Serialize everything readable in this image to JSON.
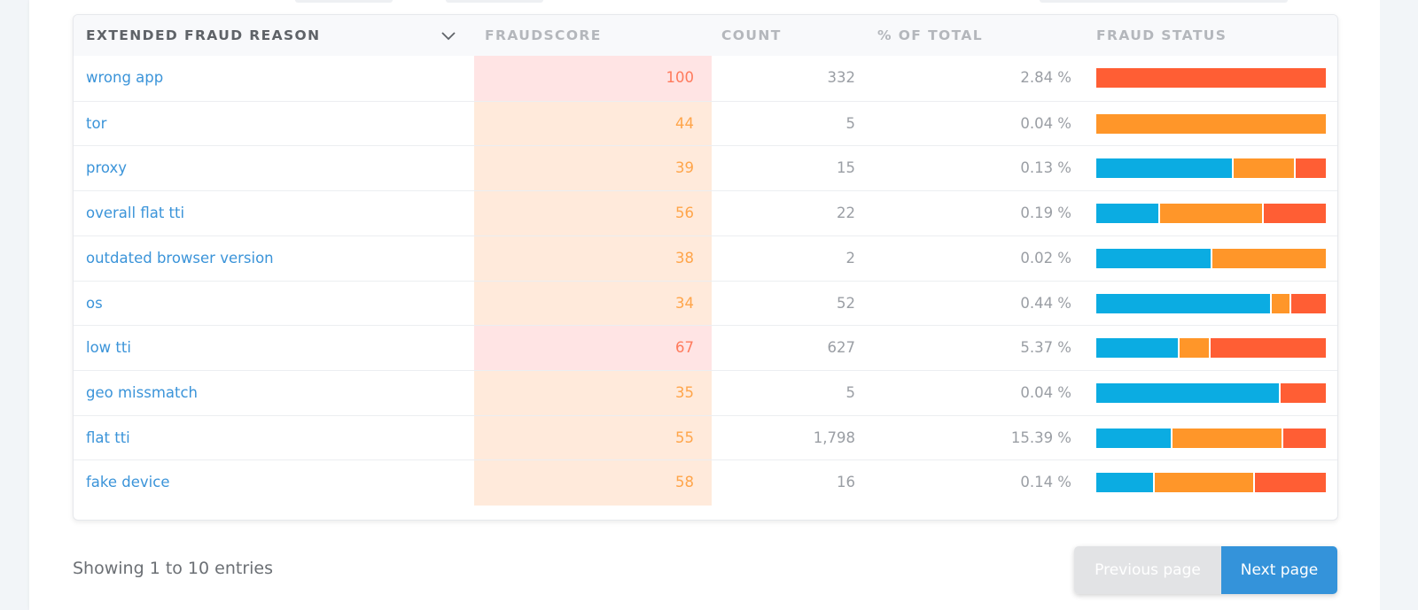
{
  "table": {
    "columns": {
      "reason": "EXTENDED FRAUD REASON",
      "fraudscore": "FRAUDSCORE",
      "count": "COUNT",
      "pct": "% OF TOTAL",
      "status": "FRAUD STATUS"
    },
    "rows": [
      {
        "reason": "wrong app",
        "score": "100",
        "count": "332",
        "pct": "2.84 %",
        "score_level": "high",
        "status_fractions": {
          "clean": 0,
          "suspicious": 0,
          "fraud": 1
        }
      },
      {
        "reason": "tor",
        "score": "44",
        "count": "5",
        "pct": "0.04 %",
        "score_level": "medium",
        "status_fractions": {
          "clean": 0,
          "suspicious": 1,
          "fraud": 0
        }
      },
      {
        "reason": "proxy",
        "score": "39",
        "count": "15",
        "pct": "0.13 %",
        "score_level": "medium",
        "status_fractions": {
          "clean": 0.6,
          "suspicious": 0.267,
          "fraud": 0.133
        }
      },
      {
        "reason": "overall flat tti",
        "score": "56",
        "count": "22",
        "pct": "0.19 %",
        "score_level": "medium",
        "status_fractions": {
          "clean": 0.273,
          "suspicious": 0.455,
          "fraud": 0.273
        }
      },
      {
        "reason": "outdated browser version",
        "score": "38",
        "count": "2",
        "pct": "0.02 %",
        "score_level": "medium",
        "status_fractions": {
          "clean": 0.5,
          "suspicious": 0.5,
          "fraud": 0
        }
      },
      {
        "reason": "os",
        "score": "34",
        "count": "52",
        "pct": "0.44 %",
        "score_level": "medium",
        "status_fractions": {
          "clean": 0.769,
          "suspicious": 0.077,
          "fraud": 0.154
        }
      },
      {
        "reason": "low tti",
        "score": "67",
        "count": "627",
        "pct": "5.37 %",
        "score_level": "high",
        "status_fractions": {
          "clean": 0.36,
          "suspicious": 0.13,
          "fraud": 0.51
        }
      },
      {
        "reason": "geo missmatch",
        "score": "35",
        "count": "5",
        "pct": "0.04 %",
        "score_level": "medium",
        "status_fractions": {
          "clean": 0.8,
          "suspicious": 0,
          "fraud": 0.2
        }
      },
      {
        "reason": "flat tti",
        "score": "55",
        "count": "1,798",
        "pct": "15.39 %",
        "score_level": "medium",
        "status_fractions": {
          "clean": 0.33,
          "suspicious": 0.48,
          "fraud": 0.19
        }
      },
      {
        "reason": "fake device",
        "score": "58",
        "count": "16",
        "pct": "0.14 %",
        "score_level": "medium",
        "status_fractions": {
          "clean": 0.25,
          "suspicious": 0.4375,
          "fraud": 0.3125
        }
      }
    ]
  },
  "footer": {
    "entries_text": "Showing 1 to 10 entries",
    "prev_label": "Previous page",
    "next_label": "Next page"
  },
  "colors": {
    "status_clean": "#0bace2",
    "status_suspicious": "#ff9629",
    "status_fraud": "#ff5e34",
    "score_high_bg": "#ffe4e4",
    "score_high_text": "#ff7a5c",
    "score_medium_bg": "#ffeadb",
    "score_medium_text": "#ffa54a",
    "link": "#3b94d9",
    "primary_button": "#3493da"
  },
  "icons": {
    "sort": "chevron-down-icon"
  }
}
